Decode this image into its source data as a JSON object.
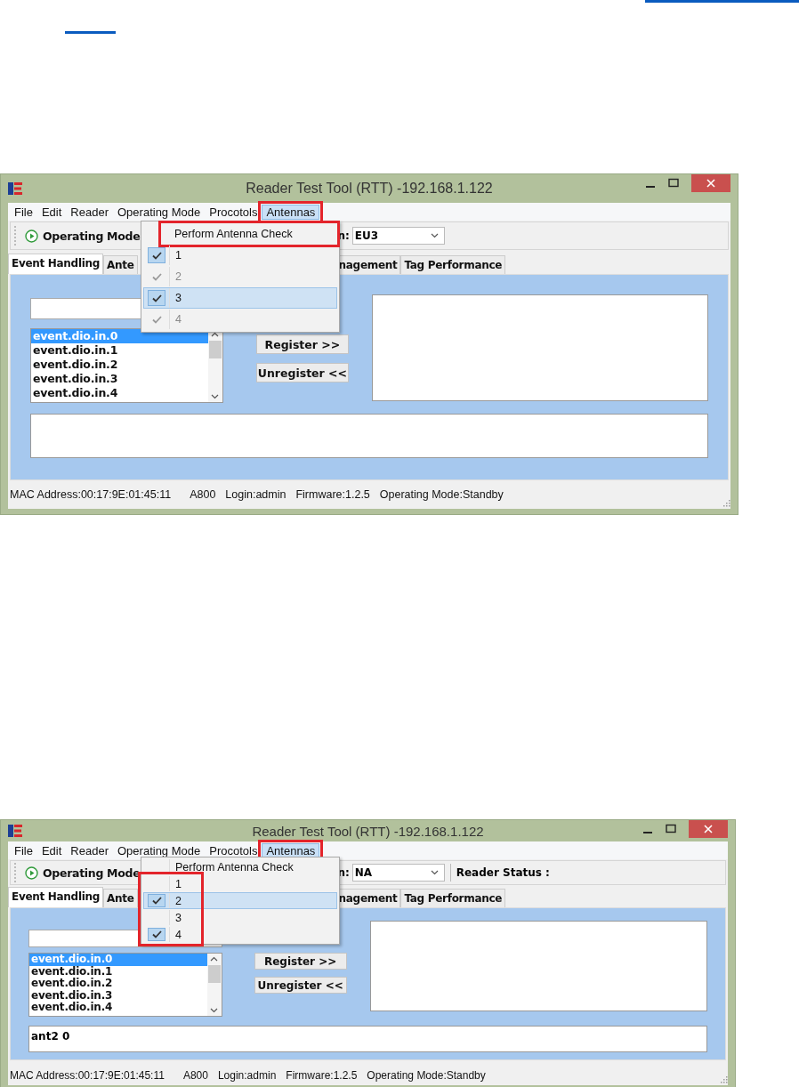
{
  "windows": [
    {
      "title": "Reader Test Tool (RTT) -192.168.1.122",
      "menus": [
        {
          "label": "File",
          "selected": false,
          "annotated": false
        },
        {
          "label": "Edit",
          "selected": false,
          "annotated": false
        },
        {
          "label": "Reader",
          "selected": false,
          "annotated": false
        },
        {
          "label": "Operating Mode",
          "selected": false,
          "annotated": false
        },
        {
          "label": "Procotols",
          "selected": false,
          "annotated": false
        },
        {
          "label": "Antennas",
          "selected": true,
          "annotated": true
        }
      ],
      "dropdown": {
        "action": {
          "label": "Perform Antenna Check",
          "annotated": true
        },
        "antennas_annotated": false,
        "antennas": [
          {
            "label": "1",
            "checked": true,
            "disabled": false,
            "selected": false
          },
          {
            "label": "2",
            "checked": true,
            "disabled": true,
            "selected": false
          },
          {
            "label": "3",
            "checked": true,
            "disabled": false,
            "selected": true
          },
          {
            "label": "4",
            "checked": true,
            "disabled": true,
            "selected": false
          }
        ]
      },
      "toolbar": {
        "mode_button": "Operating Mode",
        "field_label": "n:",
        "field_value": "EU3"
      },
      "tabs": [
        {
          "label": "Event Handling",
          "selected": true
        },
        {
          "label": "Ante",
          "selected": false
        },
        {
          "label": "nagement",
          "selected": false
        },
        {
          "label": "Tag Performance",
          "selected": false
        }
      ],
      "events": [
        {
          "label": "event.dio.in.0",
          "selected": true
        },
        {
          "label": "event.dio.in.1",
          "selected": false
        },
        {
          "label": "event.dio.in.2",
          "selected": false
        },
        {
          "label": "event.dio.in.3",
          "selected": false
        },
        {
          "label": "event.dio.in.4",
          "selected": false
        }
      ],
      "buttons": [
        "Register >>",
        "Unregister <<"
      ],
      "status": [
        "MAC Address:00:17:9E:01:45:11",
        "A800",
        "Login:admin",
        "Firmware:1.2.5",
        "Operating Mode:Standby"
      ]
    },
    {
      "title": "Reader Test Tool (RTT) -192.168.1.122",
      "menus": [
        {
          "label": "File",
          "selected": false,
          "annotated": false
        },
        {
          "label": "Edit",
          "selected": false,
          "annotated": false
        },
        {
          "label": "Reader",
          "selected": false,
          "annotated": false
        },
        {
          "label": "Operating Mode",
          "selected": false,
          "annotated": false
        },
        {
          "label": "Procotols",
          "selected": false,
          "annotated": false
        },
        {
          "label": "Antennas",
          "selected": true,
          "annotated": true
        }
      ],
      "dropdown": {
        "action": {
          "label": "Perform Antenna Check",
          "annotated": false
        },
        "antennas_annotated": true,
        "antennas": [
          {
            "label": "1",
            "checked": false,
            "disabled": false,
            "selected": false
          },
          {
            "label": "2",
            "checked": true,
            "disabled": false,
            "selected": true
          },
          {
            "label": "3",
            "checked": false,
            "disabled": false,
            "selected": false
          },
          {
            "label": "4",
            "checked": true,
            "disabled": false,
            "selected": false
          }
        ]
      },
      "toolbar": {
        "mode_button": "Operating Mode",
        "field_label": "n:",
        "field_value": "NA",
        "status_label": "Reader Status :"
      },
      "tabs": [
        {
          "label": "Event Handling",
          "selected": true
        },
        {
          "label": "Ante",
          "selected": false
        },
        {
          "label": "nagement",
          "selected": false
        },
        {
          "label": "Tag Performance",
          "selected": false
        }
      ],
      "events": [
        {
          "label": "event.dio.in.0",
          "selected": true
        },
        {
          "label": "event.dio.in.1",
          "selected": false
        },
        {
          "label": "event.dio.in.2",
          "selected": false
        },
        {
          "label": "event.dio.in.3",
          "selected": false
        },
        {
          "label": "event.dio.in.4",
          "selected": false
        }
      ],
      "buttons": [
        "Register >>",
        "Unregister <<"
      ],
      "log_lines": [
        "ant2 0"
      ],
      "status": [
        "MAC Address:00:17:9E:01:45:11",
        "A800",
        "Login:admin",
        "Firmware:1.2.5",
        "Operating Mode:Standby"
      ]
    }
  ]
}
